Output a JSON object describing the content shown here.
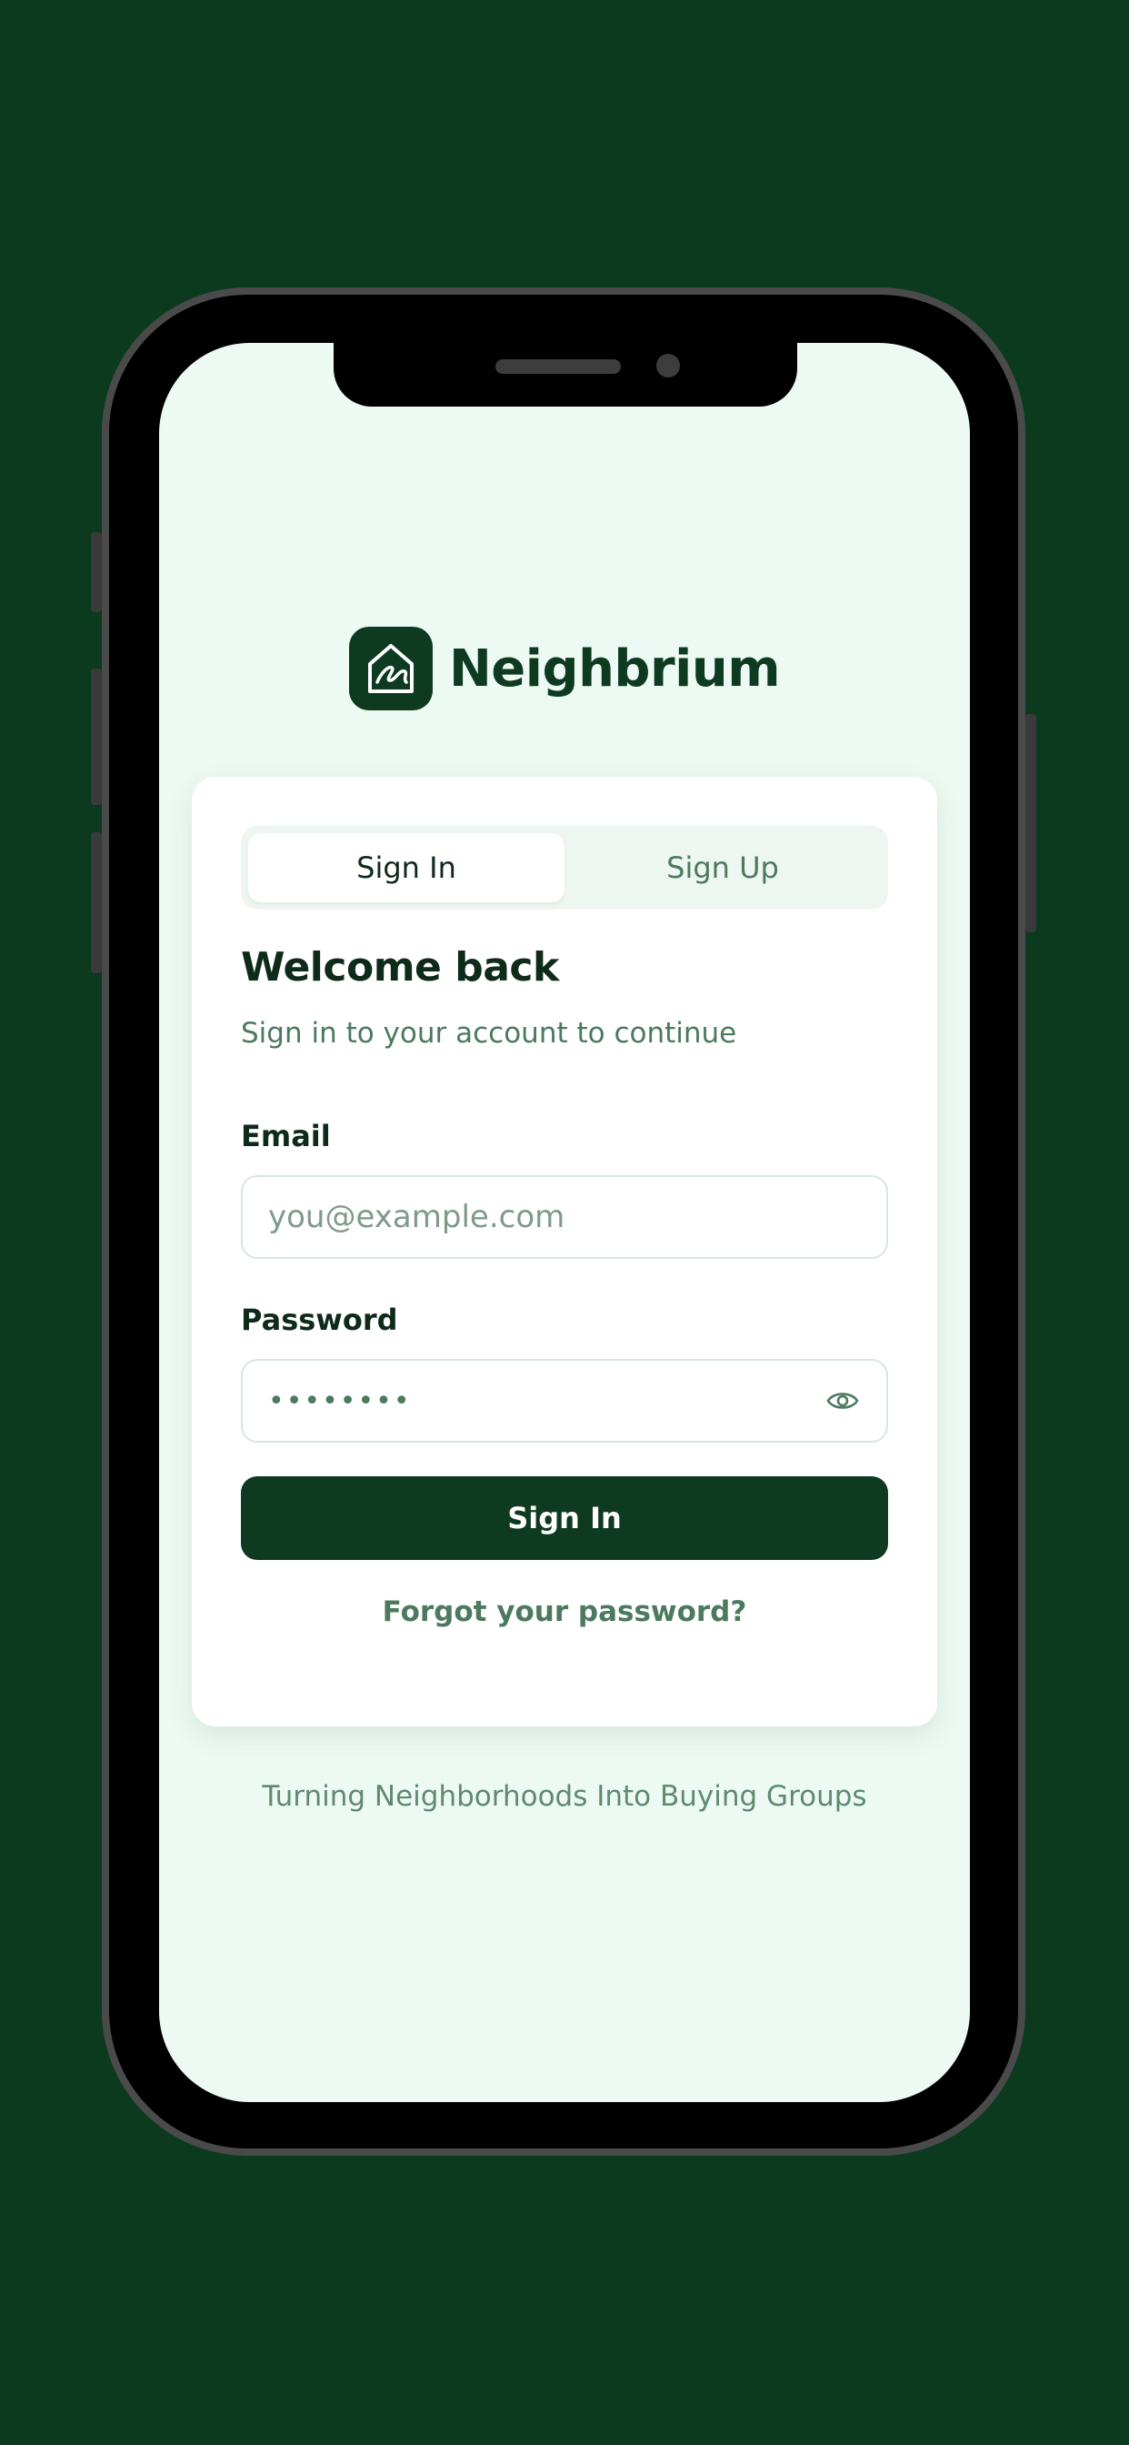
{
  "app": {
    "name": "Neighbrium",
    "tagline": "Turning Neighborhoods Into Buying Groups",
    "brand_color": "#0f3a22",
    "background_color": "#0b3a1f"
  },
  "auth": {
    "tabs": [
      {
        "label": "Sign In",
        "active": true
      },
      {
        "label": "Sign Up",
        "active": false
      }
    ],
    "title": "Welcome back",
    "subtitle": "Sign in to your account to continue",
    "email": {
      "label": "Email",
      "placeholder": "you@example.com",
      "value": ""
    },
    "password": {
      "label": "Password",
      "masked_value": "••••••••",
      "toggle_icon": "eye-icon"
    },
    "submit_label": "Sign In",
    "forgot_label": "Forgot your password?"
  },
  "icons": {
    "logo": "house-signature-logo-icon",
    "password_toggle": "eye-icon"
  }
}
